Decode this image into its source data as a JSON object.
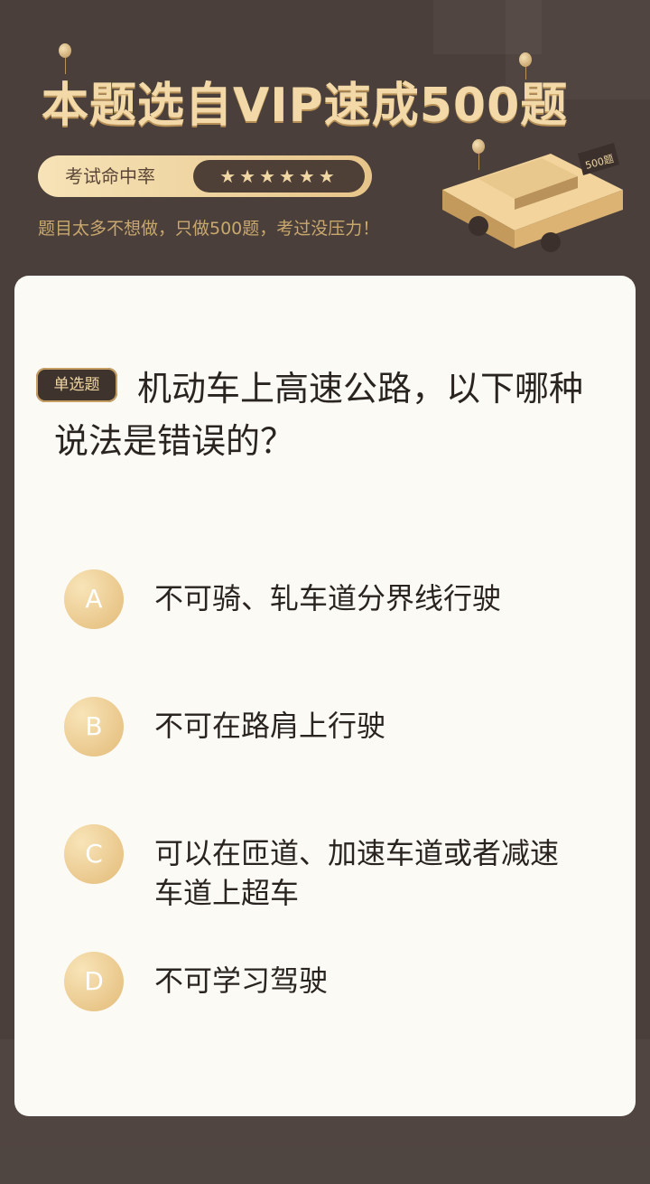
{
  "header": {
    "headline": "本题选自VIP速成500题",
    "rate_label": "考试命中率",
    "stars": "★★★★★★",
    "slogan": "题目太多不想做，只做500题，考过没压力！",
    "car_badge": "500题"
  },
  "question": {
    "tag": "单选题",
    "text": "机动车上高速公路，以下哪种说法是错误的？"
  },
  "options": [
    {
      "letter": "A",
      "text": "不可骑、轧车道分界线行驶"
    },
    {
      "letter": "B",
      "text": "不可在路肩上行驶"
    },
    {
      "letter": "C",
      "text": "可以在匝道、加速车道或者减速车道上超车"
    },
    {
      "letter": "D",
      "text": "不可学习驾驶"
    }
  ],
  "colors": {
    "background": "#4a3f3a",
    "gold": "#e3bb78",
    "card": "#fcfaf4"
  }
}
